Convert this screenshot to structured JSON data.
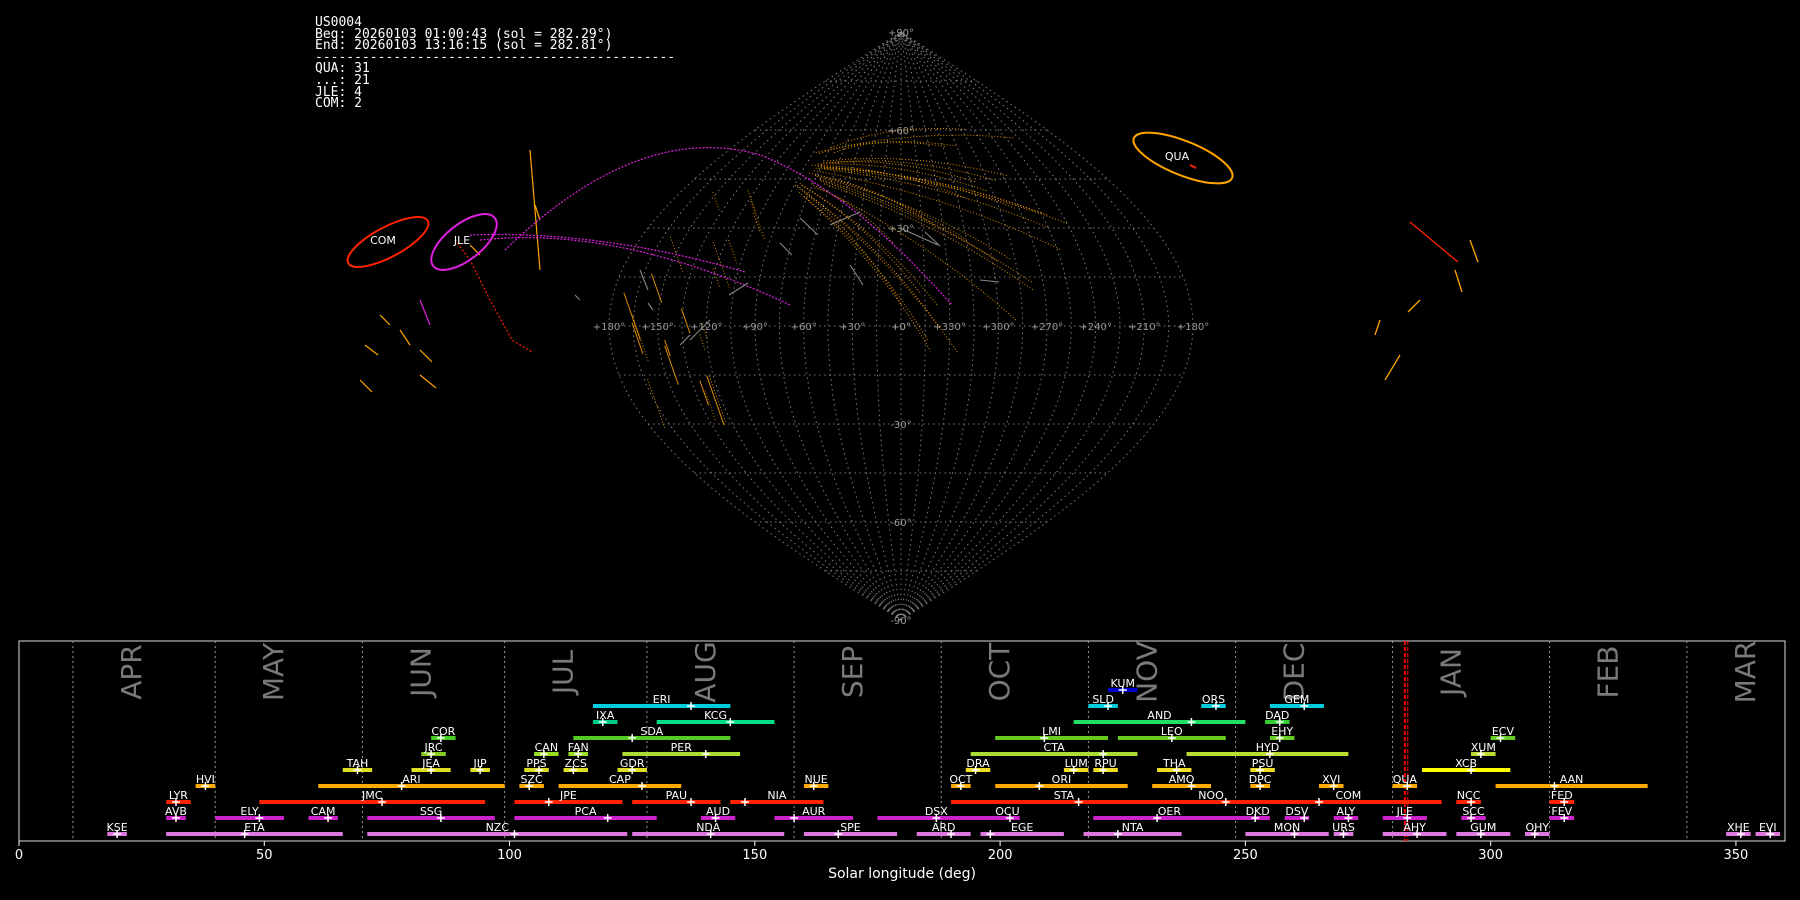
{
  "info": {
    "station": "US0004",
    "begin": "Beg: 20260103 01:00:43 (sol = 282.29°)",
    "end": "End: 20260103 13:16:15 (sol = 282.81°)",
    "separator": "----------------------------------------------",
    "counts": [
      "QUA: 31",
      "...: 21",
      "JLE: 4",
      "COM: 2"
    ]
  },
  "colors": {
    "background": "#000000",
    "grid": "#8a8a8a",
    "sporadic": "#ffa500",
    "qua": "#ff2200",
    "jle": "#e020e0",
    "com": "#ff2200",
    "current_sol_line": "#ff0000"
  },
  "chart_data": [
    {
      "type": "scatter",
      "projection": "sinusoidal",
      "title": "",
      "lon_tick_labels": [
        "+180°",
        "+150°",
        "+120°",
        "+90°",
        "+60°",
        "+30°",
        "+0°",
        "+330°",
        "+300°",
        "+270°",
        "+240°",
        "+210°",
        "+180°"
      ],
      "lat_tick_labels": [
        "+90°",
        "+60°",
        "+30°",
        "+0°",
        "-30°",
        "-60°",
        "-90°"
      ],
      "radiants": [
        {
          "name": "QUA",
          "lon": 228,
          "lat": 52,
          "color": "#ffa500"
        },
        {
          "name": "JLE",
          "lon": 133,
          "lat": 27,
          "color": "#e020e0"
        },
        {
          "name": "COM",
          "lon": 152,
          "lat": 27,
          "color": "#ff2200"
        }
      ]
    },
    {
      "type": "bar",
      "xlabel": "Solar longitude (deg)",
      "xlim": [
        0,
        360
      ],
      "x_ticks": [
        0,
        50,
        100,
        150,
        200,
        250,
        300,
        350
      ],
      "months": [
        {
          "label": "APR",
          "start": 11
        },
        {
          "label": "MAY",
          "start": 40
        },
        {
          "label": "JUN",
          "start": 70
        },
        {
          "label": "JUL",
          "start": 99
        },
        {
          "label": "AUG",
          "start": 128
        },
        {
          "label": "SEP",
          "start": 158
        },
        {
          "label": "OCT",
          "start": 188
        },
        {
          "label": "NOV",
          "start": 218
        },
        {
          "label": "DEC",
          "start": 248
        },
        {
          "label": "JAN",
          "start": 280
        },
        {
          "label": "FEB",
          "start": 312
        },
        {
          "label": "MAR",
          "start": 340
        }
      ],
      "current_sol": 282.5,
      "showers": [
        {
          "name": "KUM",
          "start": 222,
          "end": 228,
          "peak": 225,
          "level": 9,
          "color": "#0000cc"
        },
        {
          "name": "ERI",
          "start": 117,
          "end": 145,
          "peak": 137,
          "level": 8,
          "color": "#00ccdd"
        },
        {
          "name": "SLD",
          "start": 218,
          "end": 224,
          "peak": 222,
          "level": 8,
          "color": "#00ccdd"
        },
        {
          "name": "ORS",
          "start": 241,
          "end": 246,
          "peak": 244,
          "level": 8,
          "color": "#00ccdd"
        },
        {
          "name": "GEM",
          "start": 255,
          "end": 266,
          "peak": 262,
          "level": 8,
          "color": "#00ccdd"
        },
        {
          "name": "IXA",
          "start": 117,
          "end": 122,
          "peak": 119,
          "level": 7,
          "color": "#00cc88"
        },
        {
          "name": "KCG",
          "start": 130,
          "end": 154,
          "peak": 145,
          "level": 7,
          "color": "#00dd88"
        },
        {
          "name": "AND",
          "start": 215,
          "end": 250,
          "peak": 239,
          "level": 7,
          "color": "#22dd66"
        },
        {
          "name": "DAD",
          "start": 254,
          "end": 259,
          "peak": 257,
          "level": 7,
          "color": "#33cc33"
        },
        {
          "name": "COR",
          "start": 84,
          "end": 89,
          "peak": 86,
          "level": 6,
          "color": "#44cc22"
        },
        {
          "name": "SDA",
          "start": 113,
          "end": 145,
          "peak": 125,
          "level": 6,
          "color": "#55cc22"
        },
        {
          "name": "LMI",
          "start": 199,
          "end": 222,
          "peak": 209,
          "level": 6,
          "color": "#66cc22"
        },
        {
          "name": "LEO",
          "start": 224,
          "end": 246,
          "peak": 235,
          "level": 6,
          "color": "#66cc22"
        },
        {
          "name": "EHY",
          "start": 255,
          "end": 260,
          "peak": 257,
          "level": 6,
          "color": "#66cc22"
        },
        {
          "name": "ECV",
          "start": 300,
          "end": 305,
          "peak": 302,
          "level": 6,
          "color": "#66cc22"
        },
        {
          "name": "JRC",
          "start": 82,
          "end": 87,
          "peak": 84,
          "level": 5,
          "color": "#88cc22"
        },
        {
          "name": "CAN",
          "start": 105,
          "end": 110,
          "peak": 107,
          "level": 5,
          "color": "#99dd22"
        },
        {
          "name": "FAN",
          "start": 112,
          "end": 116,
          "peak": 114,
          "level": 5,
          "color": "#99dd22"
        },
        {
          "name": "PER",
          "start": 123,
          "end": 147,
          "peak": 140,
          "level": 5,
          "color": "#aadd33"
        },
        {
          "name": "CTA",
          "start": 194,
          "end": 228,
          "peak": 221,
          "level": 5,
          "color": "#aadd33"
        },
        {
          "name": "HYD",
          "start": 238,
          "end": 271,
          "peak": 255,
          "level": 5,
          "color": "#bbdd33"
        },
        {
          "name": "XUM",
          "start": 296,
          "end": 301,
          "peak": 298,
          "level": 5,
          "color": "#bbdd33"
        },
        {
          "name": "TAH",
          "start": 66,
          "end": 72,
          "peak": 69,
          "level": 4,
          "color": "#dddd22"
        },
        {
          "name": "JEA",
          "start": 80,
          "end": 88,
          "peak": 84,
          "level": 4,
          "color": "#dddd22"
        },
        {
          "name": "JIP",
          "start": 92,
          "end": 96,
          "peak": 94,
          "level": 4,
          "color": "#dddd22"
        },
        {
          "name": "PPS",
          "start": 103,
          "end": 108,
          "peak": 106,
          "level": 4,
          "color": "#dddd22"
        },
        {
          "name": "ZCS",
          "start": 111,
          "end": 116,
          "peak": 113,
          "level": 4,
          "color": "#dddd22"
        },
        {
          "name": "GDR",
          "start": 122,
          "end": 128,
          "peak": 125,
          "level": 4,
          "color": "#dddd22"
        },
        {
          "name": "DRA",
          "start": 193,
          "end": 198,
          "peak": 195,
          "level": 4,
          "color": "#eedd22"
        },
        {
          "name": "LUM",
          "start": 213,
          "end": 218,
          "peak": 215,
          "level": 4,
          "color": "#eedd22"
        },
        {
          "name": "RPU",
          "start": 219,
          "end": 224,
          "peak": 221,
          "level": 4,
          "color": "#eedd22"
        },
        {
          "name": "THA",
          "start": 232,
          "end": 239,
          "peak": 236,
          "level": 4,
          "color": "#eedd22"
        },
        {
          "name": "PSU",
          "start": 251,
          "end": 256,
          "peak": 253,
          "level": 4,
          "color": "#eedd22"
        },
        {
          "name": "XCB",
          "start": 286,
          "end": 304,
          "peak": 296,
          "level": 4,
          "color": "#ffff00"
        },
        {
          "name": "HVI",
          "start": 36,
          "end": 40,
          "peak": 38,
          "level": 3,
          "color": "#ffaa00"
        },
        {
          "name": "ARI",
          "start": 61,
          "end": 99,
          "peak": 78,
          "level": 3,
          "color": "#ffaa00"
        },
        {
          "name": "SZC",
          "start": 102,
          "end": 107,
          "peak": 104,
          "level": 3,
          "color": "#ffaa00"
        },
        {
          "name": "CAP",
          "start": 110,
          "end": 135,
          "peak": 127,
          "level": 3,
          "color": "#ffaa00"
        },
        {
          "name": "NUE",
          "start": 160,
          "end": 165,
          "peak": 162,
          "level": 3,
          "color": "#ffaa00"
        },
        {
          "name": "OCT",
          "start": 190,
          "end": 194,
          "peak": 192,
          "level": 3,
          "color": "#ffaa00"
        },
        {
          "name": "ORI",
          "start": 199,
          "end": 226,
          "peak": 208,
          "level": 3,
          "color": "#ffaa00"
        },
        {
          "name": "AMO",
          "start": 231,
          "end": 243,
          "peak": 239,
          "level": 3,
          "color": "#ffaa00"
        },
        {
          "name": "DPC",
          "start": 251,
          "end": 255,
          "peak": 253,
          "level": 3,
          "color": "#ffaa00"
        },
        {
          "name": "XVI",
          "start": 265,
          "end": 270,
          "peak": 268,
          "level": 3,
          "color": "#ffaa00"
        },
        {
          "name": "QUA",
          "start": 280,
          "end": 285,
          "peak": 283,
          "level": 3,
          "color": "#ffaa00"
        },
        {
          "name": "AAN",
          "start": 301,
          "end": 332,
          "peak": 313,
          "level": 3,
          "color": "#ffaa00"
        },
        {
          "name": "LYR",
          "start": 30,
          "end": 35,
          "peak": 32,
          "level": 2,
          "color": "#ff2200"
        },
        {
          "name": "JMC",
          "start": 49,
          "end": 95,
          "peak": 74,
          "level": 2,
          "color": "#ff2200"
        },
        {
          "name": "JPE",
          "start": 101,
          "end": 123,
          "peak": 108,
          "level": 2,
          "color": "#ff2200"
        },
        {
          "name": "PAU",
          "start": 125,
          "end": 143,
          "peak": 137,
          "level": 2,
          "color": "#ff2200"
        },
        {
          "name": "NIA",
          "start": 145,
          "end": 164,
          "peak": 148,
          "level": 2,
          "color": "#ff2200"
        },
        {
          "name": "STA",
          "start": 190,
          "end": 236,
          "peak": 216,
          "level": 2,
          "color": "#ff2200"
        },
        {
          "name": "NOO",
          "start": 233,
          "end": 253,
          "peak": 246,
          "level": 2,
          "color": "#ff2200"
        },
        {
          "name": "COM",
          "start": 252,
          "end": 290,
          "peak": 265,
          "level": 2,
          "color": "#ff2200"
        },
        {
          "name": "NCC",
          "start": 293,
          "end": 298,
          "peak": 296,
          "level": 2,
          "color": "#ff2200"
        },
        {
          "name": "FED",
          "start": 312,
          "end": 317,
          "peak": 315,
          "level": 2,
          "color": "#ff2200"
        },
        {
          "name": "AVB",
          "start": 30,
          "end": 34,
          "peak": 32,
          "level": 1,
          "color": "#cc22cc"
        },
        {
          "name": "ELY",
          "start": 40,
          "end": 54,
          "peak": 49,
          "level": 1,
          "color": "#cc22cc"
        },
        {
          "name": "CAM",
          "start": 59,
          "end": 65,
          "peak": 63,
          "level": 1,
          "color": "#cc22cc"
        },
        {
          "name": "SSG",
          "start": 71,
          "end": 97,
          "peak": 86,
          "level": 1,
          "color": "#cc22cc"
        },
        {
          "name": "PCA",
          "start": 101,
          "end": 130,
          "peak": 120,
          "level": 1,
          "color": "#cc22cc"
        },
        {
          "name": "AUD",
          "start": 139,
          "end": 146,
          "peak": 142,
          "level": 1,
          "color": "#cc22cc"
        },
        {
          "name": "AUR",
          "start": 154,
          "end": 170,
          "peak": 158,
          "level": 1,
          "color": "#cc22cc"
        },
        {
          "name": "DSX",
          "start": 175,
          "end": 199,
          "peak": 187,
          "level": 1,
          "color": "#cc22cc"
        },
        {
          "name": "OCU",
          "start": 199,
          "end": 204,
          "peak": 202,
          "level": 1,
          "color": "#cc22cc"
        },
        {
          "name": "OER",
          "start": 219,
          "end": 250,
          "peak": 232,
          "level": 1,
          "color": "#cc22cc"
        },
        {
          "name": "DKD",
          "start": 250,
          "end": 255,
          "peak": 252,
          "level": 1,
          "color": "#cc22cc"
        },
        {
          "name": "DSV",
          "start": 258,
          "end": 263,
          "peak": 262,
          "level": 1,
          "color": "#cc22cc"
        },
        {
          "name": "ALY",
          "start": 268,
          "end": 273,
          "peak": 271,
          "level": 1,
          "color": "#cc22cc"
        },
        {
          "name": "JLE",
          "start": 278,
          "end": 287,
          "peak": 283,
          "level": 1,
          "color": "#cc22cc"
        },
        {
          "name": "SCC",
          "start": 294,
          "end": 299,
          "peak": 296,
          "level": 1,
          "color": "#cc22cc"
        },
        {
          "name": "FEV",
          "start": 312,
          "end": 317,
          "peak": 315,
          "level": 1,
          "color": "#cc22cc"
        },
        {
          "name": "KSE",
          "start": 18,
          "end": 22,
          "peak": 20,
          "level": 0,
          "color": "#dd77dd"
        },
        {
          "name": "ETA",
          "start": 30,
          "end": 66,
          "peak": 46,
          "level": 0,
          "color": "#dd77dd"
        },
        {
          "name": "NZC",
          "start": 71,
          "end": 124,
          "peak": 101,
          "level": 0,
          "color": "#dd77dd"
        },
        {
          "name": "NDA",
          "start": 125,
          "end": 156,
          "peak": 141,
          "level": 0,
          "color": "#dd77dd"
        },
        {
          "name": "SPE",
          "start": 160,
          "end": 179,
          "peak": 167,
          "level": 0,
          "color": "#dd77dd"
        },
        {
          "name": "ARD",
          "start": 183,
          "end": 194,
          "peak": 190,
          "level": 0,
          "color": "#dd77dd"
        },
        {
          "name": "EGE",
          "start": 196,
          "end": 213,
          "peak": 198,
          "level": 0,
          "color": "#dd77dd"
        },
        {
          "name": "NTA",
          "start": 217,
          "end": 237,
          "peak": 224,
          "level": 0,
          "color": "#dd77dd"
        },
        {
          "name": "MON",
          "start": 250,
          "end": 267,
          "peak": 260,
          "level": 0,
          "color": "#dd77dd"
        },
        {
          "name": "URS",
          "start": 268,
          "end": 272,
          "peak": 270,
          "level": 0,
          "color": "#dd77dd"
        },
        {
          "name": "AHY",
          "start": 278,
          "end": 291,
          "peak": 285,
          "level": 0,
          "color": "#dd77dd"
        },
        {
          "name": "GUM",
          "start": 293,
          "end": 304,
          "peak": 298,
          "level": 0,
          "color": "#dd77dd"
        },
        {
          "name": "OHY",
          "start": 307,
          "end": 312,
          "peak": 309,
          "level": 0,
          "color": "#dd77dd"
        },
        {
          "name": "XHE",
          "start": 348,
          "end": 353,
          "peak": 351,
          "level": 0,
          "color": "#dd77dd"
        },
        {
          "name": "EVI",
          "start": 354,
          "end": 359,
          "peak": 357,
          "level": 0,
          "color": "#dd77dd"
        }
      ]
    }
  ]
}
